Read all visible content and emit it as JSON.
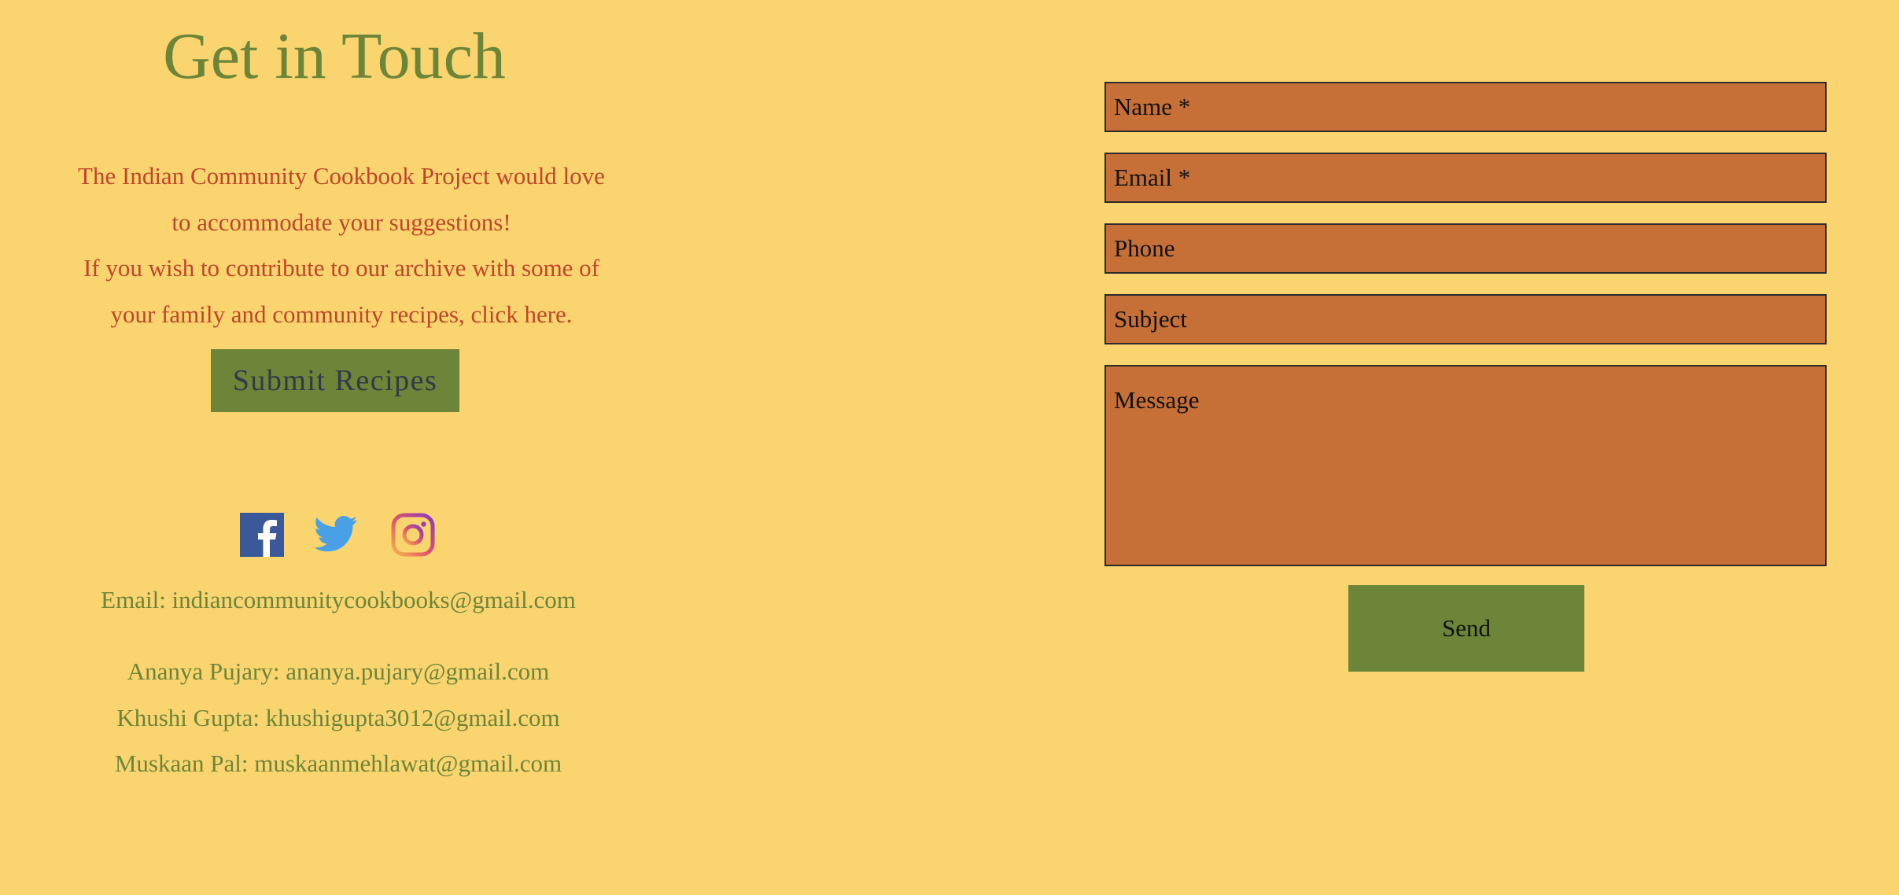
{
  "heading": "Get in Touch",
  "intro": {
    "paragraph1": "The Indian Community Cookbook Project would love to accommodate your suggestions!",
    "paragraph2": "If you wish to contribute to our archive with some of your family and community recipes, click here."
  },
  "submit_button_label": "Submit Recipes",
  "social": [
    {
      "name": "facebook-icon"
    },
    {
      "name": "twitter-icon"
    },
    {
      "name": "instagram-icon"
    }
  ],
  "contact": {
    "email_line": "Email: indiancommunitycookbooks@gmail.com",
    "team": [
      "Ananya Pujary: ananya.pujary@gmail.com",
      "Khushi Gupta: khushigupta3012@gmail.com",
      "Muskaan Pal: muskaanmehlawat@gmail.com"
    ]
  },
  "form": {
    "name_placeholder": "Name *",
    "email_placeholder": "Email *",
    "phone_placeholder": "Phone",
    "subject_placeholder": "Subject",
    "message_placeholder": "Message",
    "send_label": "Send"
  },
  "colors": {
    "background": "#fad46f",
    "accent_green": "#6d8538",
    "intro_text": "#c0462a",
    "field_bg": "#c66f37",
    "facebook": "#3b5998",
    "twitter": "#4aa0e6"
  }
}
